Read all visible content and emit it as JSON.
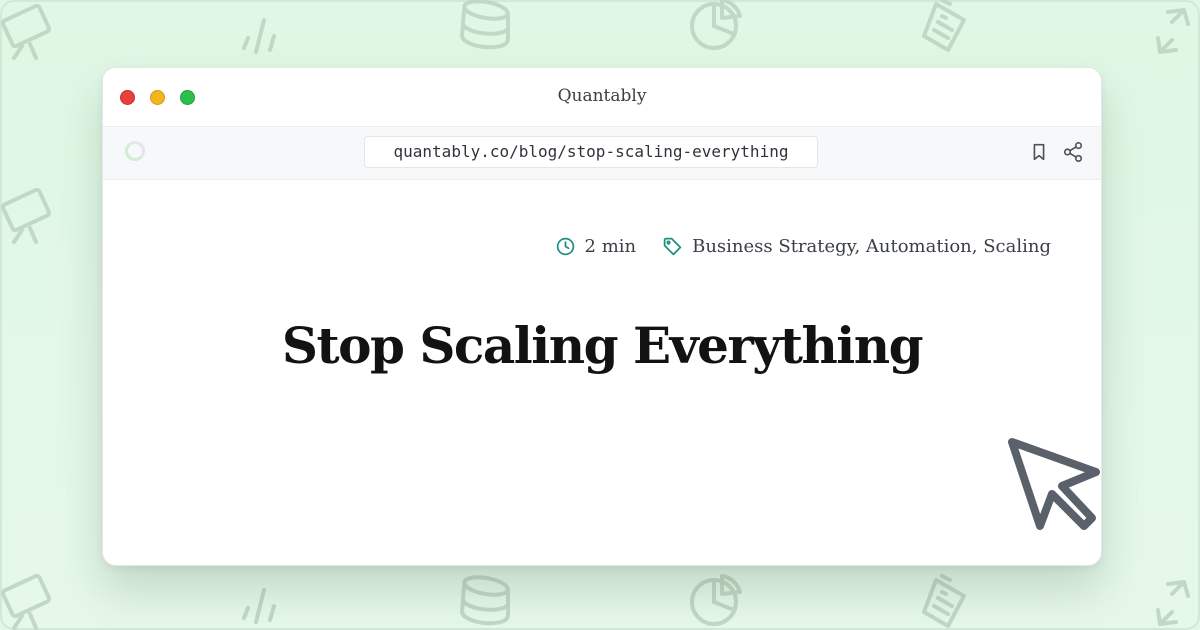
{
  "window": {
    "title": "Quantably"
  },
  "toolbar": {
    "url": "quantably.co/blog/stop-scaling-everything"
  },
  "post": {
    "read_time": "2 min",
    "tags": "Business Strategy, Automation, Scaling",
    "title": "Stop Scaling Everything"
  },
  "colors": {
    "background": "#e2f7e6",
    "accent": "#1e9083",
    "traffic_red": "#e6413c",
    "traffic_yellow": "#f3b51f",
    "traffic_green": "#2bbf4e"
  },
  "icons": {
    "background_pattern": [
      "presentation-icon",
      "bar-chart-icon",
      "database-icon",
      "pie-chart-icon",
      "document-icon",
      "expand-icon"
    ],
    "toolbar": [
      "loading-icon",
      "bookmark-icon",
      "share-icon"
    ],
    "meta": [
      "clock-icon",
      "tag-icon"
    ],
    "overlay": "cursor-icon"
  }
}
